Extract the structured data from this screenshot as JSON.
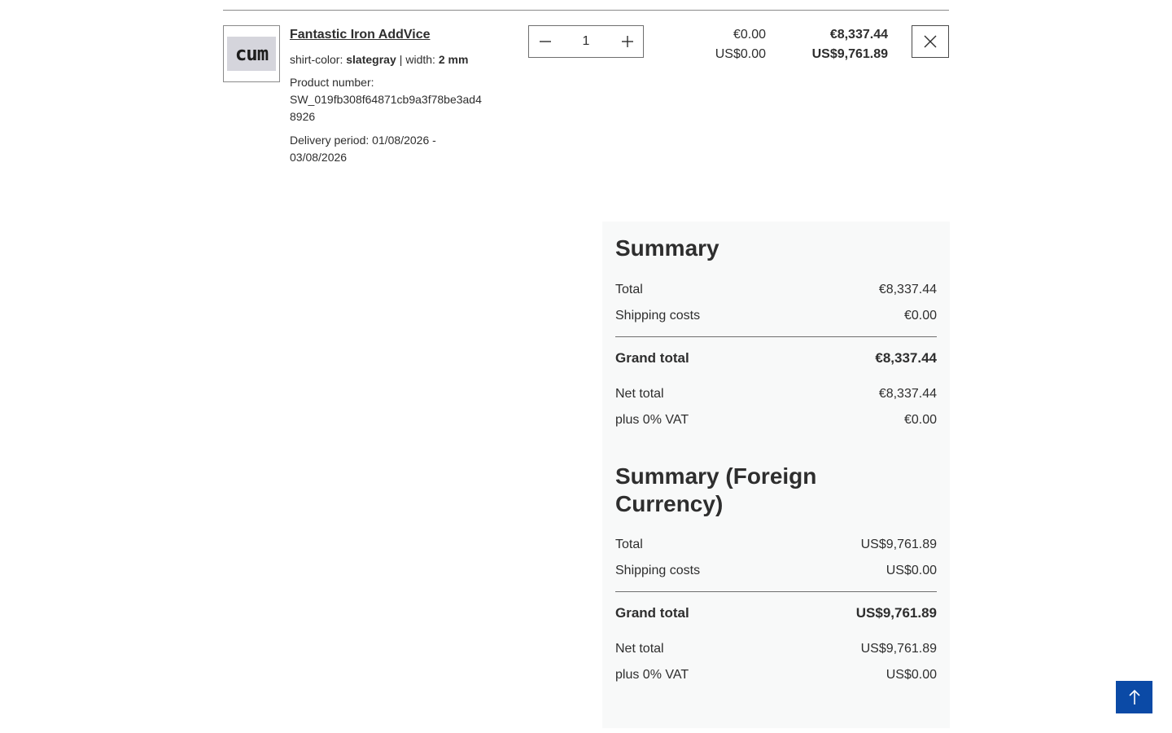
{
  "line_item": {
    "product_name": "Fantastic Iron AddVice",
    "thumbnail_text": "cum",
    "options": [
      {
        "label": "shirt-color:",
        "value": "slategray"
      },
      {
        "label": "width:",
        "value": "2 mm"
      }
    ],
    "options_separator": "|",
    "product_number_label": "Product number:",
    "product_number": "SW_019fb308f64871cb9a3f78be3ad48926",
    "delivery_period_label": "Delivery period:",
    "delivery_period": "01/08/2026 - 03/08/2026",
    "quantity": "1",
    "unit_price_eur": "€0.00",
    "unit_price_usd": "US$0.00",
    "total_price_eur": "€8,337.44",
    "total_price_usd": "US$9,761.89"
  },
  "summary": {
    "title": "Summary",
    "total_label": "Total",
    "total": "€8,337.44",
    "shipping_label": "Shipping costs",
    "shipping": "€0.00",
    "grand_total_label": "Grand total",
    "grand_total": "€8,337.44",
    "net_total_label": "Net total",
    "net_total": "€8,337.44",
    "vat_label": "plus 0% VAT",
    "vat": "€0.00"
  },
  "summary_foreign": {
    "title": "Summary (Foreign Currency)",
    "total_label": "Total",
    "total": "US$9,761.89",
    "shipping_label": "Shipping costs",
    "shipping": "US$0.00",
    "grand_total_label": "Grand total",
    "grand_total": "US$9,761.89",
    "net_total_label": "Net total",
    "net_total": "US$9,761.89",
    "vat_label": "plus 0% VAT",
    "vat": "US$0.00"
  },
  "colors": {
    "accent": "#0b4aa6",
    "summary_background": "#f8f9f9"
  },
  "icons": {
    "decrease": "minus-icon",
    "increase": "plus-icon",
    "remove": "close-icon",
    "scroll_top": "arrow-up-icon"
  }
}
